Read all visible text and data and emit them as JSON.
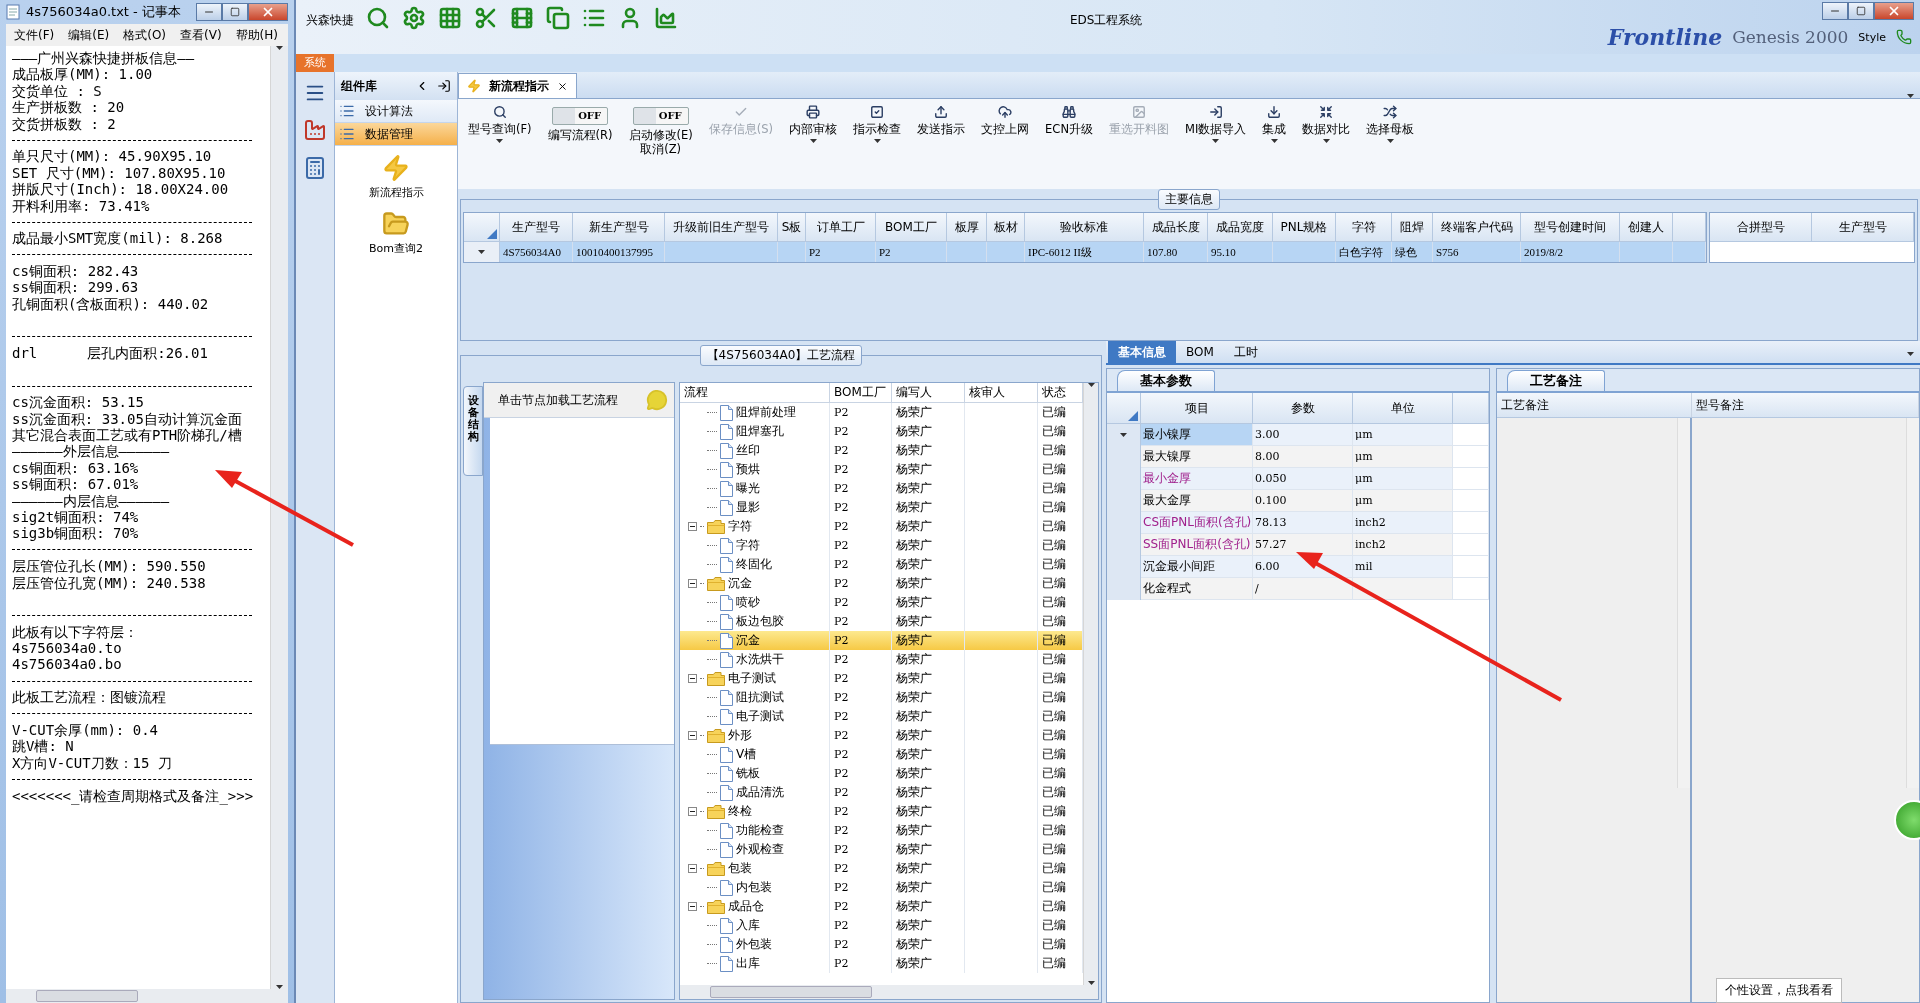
{
  "notepad": {
    "title": "4s756034a0.txt - 记事本",
    "menu": [
      "文件(F)",
      "编辑(E)",
      "格式(O)",
      "查看(V)",
      "帮助(H)"
    ],
    "lines": [
      {
        "kind": "text",
        "text": "———广州兴森快捷拼板信息——"
      },
      {
        "kind": "text",
        "text": "成品板厚(MM): 1.00"
      },
      {
        "kind": "text",
        "text": "交货单位 : S"
      },
      {
        "kind": "text",
        "text": "生产拼板数 : 20"
      },
      {
        "kind": "text",
        "text": "交货拼板数 : 2"
      },
      {
        "kind": "rule"
      },
      {
        "kind": "text",
        "text": "单只尺寸(MM): 45.90X95.10"
      },
      {
        "kind": "text",
        "text": "SET 尺寸(MM): 107.80X95.10"
      },
      {
        "kind": "text",
        "text": "拼版尺寸(Inch): 18.00X24.00"
      },
      {
        "kind": "text",
        "text": "开料利用率: 73.41%"
      },
      {
        "kind": "rule"
      },
      {
        "kind": "text",
        "text": "成品最小SMT宽度(mil): 8.268"
      },
      {
        "kind": "rule"
      },
      {
        "kind": "text",
        "text": "cs铜面积: 282.43"
      },
      {
        "kind": "text",
        "text": "ss铜面积: 299.63"
      },
      {
        "kind": "text",
        "text": "孔铜面积(含板面积): 440.02"
      },
      {
        "kind": "gap"
      },
      {
        "kind": "rule"
      },
      {
        "kind": "split",
        "left": "drl",
        "right": "层孔内面积:26.01"
      },
      {
        "kind": "gap"
      },
      {
        "kind": "rule"
      },
      {
        "kind": "text",
        "text": "cs沉金面积: 53.15"
      },
      {
        "kind": "text",
        "text": "ss沉金面积: 33.05自动计算沉金面"
      },
      {
        "kind": "text",
        "text": "其它混合表面工艺或有PTH阶梯孔/槽"
      },
      {
        "kind": "text",
        "text": "——————外层信息——————"
      },
      {
        "kind": "text",
        "text": "cs铜面积: 63.16%"
      },
      {
        "kind": "text",
        "text": "ss铜面积: 67.01%"
      },
      {
        "kind": "text",
        "text": "——————内层信息——————"
      },
      {
        "kind": "text",
        "text": "sig2t铜面积: 74%"
      },
      {
        "kind": "text",
        "text": "sig3b铜面积: 70%"
      },
      {
        "kind": "rule"
      },
      {
        "kind": "text",
        "text": "层压管位孔长(MM): 590.550"
      },
      {
        "kind": "text",
        "text": "层压管位孔宽(MM): 240.538"
      },
      {
        "kind": "gap"
      },
      {
        "kind": "rule"
      },
      {
        "kind": "text",
        "text": "此板有以下字符层："
      },
      {
        "kind": "text",
        "text": "4s756034a0.to"
      },
      {
        "kind": "text",
        "text": "4s756034a0.bo"
      },
      {
        "kind": "rule"
      },
      {
        "kind": "text",
        "text": "此板工艺流程：图镀流程"
      },
      {
        "kind": "rule"
      },
      {
        "kind": "text",
        "text": "V-CUT余厚(mm): 0.4"
      },
      {
        "kind": "text",
        "text": "跳V槽: N"
      },
      {
        "kind": "text",
        "text": "X方向V-CUT刀数：15 刀"
      },
      {
        "kind": "rule"
      },
      {
        "kind": "text",
        "text": "<<<<<<<_请检查周期格式及备注_>>>"
      }
    ]
  },
  "app": {
    "quick_name": "兴森快捷",
    "title": "EDS工程系统",
    "backdrop": [
      "Frontline",
      "Genesis 2000",
      "Style"
    ],
    "ribbon_tab": "系统"
  },
  "component_panel": {
    "title": "组件库",
    "items": [
      {
        "label": "设计算法",
        "selected": false
      },
      {
        "label": "数据管理",
        "selected": true
      }
    ],
    "shortcuts": [
      {
        "kind": "bolt",
        "label": "新流程指示"
      },
      {
        "kind": "folder",
        "label": "Bom查询2"
      }
    ]
  },
  "document_tab": {
    "label": "新流程指示",
    "selected": true
  },
  "toolbar": {
    "items": [
      {
        "kind": "button",
        "label": "型号查询(F)",
        "disabled": false,
        "caret": true
      },
      {
        "kind": "toggle",
        "switch": "OFF",
        "on": false,
        "label": "编写流程(R)"
      },
      {
        "kind": "toggle",
        "switch": "OFF",
        "on": false,
        "label": "启动修改(E)",
        "label2": "取消(Z)"
      },
      {
        "kind": "button",
        "label": "保存信息(S)",
        "disabled": true,
        "caret": false
      },
      {
        "kind": "button",
        "label": "内部审核",
        "disabled": false,
        "caret": true
      },
      {
        "kind": "button",
        "label": "指示检查",
        "disabled": false,
        "caret": true
      },
      {
        "kind": "button",
        "label": "发送指示",
        "disabled": false,
        "caret": false
      },
      {
        "kind": "button",
        "label": "文控上网",
        "disabled": false,
        "caret": false
      },
      {
        "kind": "button",
        "label": "ECN升级",
        "disabled": false,
        "caret": false
      },
      {
        "kind": "button",
        "label": "重选开料图",
        "disabled": true,
        "caret": false
      },
      {
        "kind": "button",
        "label": "MI数据导入",
        "disabled": false,
        "caret": true
      },
      {
        "kind": "button",
        "label": "集成",
        "disabled": false,
        "caret": true
      },
      {
        "kind": "button",
        "label": "数据对比",
        "disabled": false,
        "caret": true
      },
      {
        "kind": "button",
        "label": "选择母板",
        "disabled": false,
        "caret": true
      }
    ]
  },
  "main_info": {
    "title": "主要信息",
    "columns": [
      "生产型号",
      "新生产型号",
      "升级前旧生产型号",
      "S板",
      "订单工厂",
      "BOM工厂",
      "板厚",
      "板材",
      "验收标准",
      "成品长度",
      "成品宽度",
      "PNL规格",
      "字符",
      "阻焊",
      "终端客户代码",
      "型号创建时间",
      "创建人"
    ],
    "rows": [
      {
        "selected": true,
        "cells": [
          "4S756034A0",
          "10010400137995",
          null,
          null,
          "P2",
          "P2",
          null,
          null,
          "IPC-6012 II级",
          "107.80",
          "95.10",
          null,
          "白色字符",
          "绿色",
          "S756",
          "2019/8/2",
          null
        ]
      }
    ],
    "merge_columns": [
      "合拼型号",
      "生产型号"
    ]
  },
  "process": {
    "title": "【4S756034A0】工艺流程",
    "side_tab": "设备结构",
    "hint": "单击节点加载工艺流程",
    "columns": [
      "流程",
      "BOM工厂",
      "编写人",
      "核审人",
      "状态"
    ],
    "tree": [
      {
        "kind": "group",
        "children": [
          {
            "kind": "step",
            "label": "阻焊前处理",
            "factory": "P2",
            "writer": "杨荣广",
            "status": "已编",
            "selected": false
          },
          {
            "kind": "step",
            "label": "阻焊塞孔",
            "factory": "P2",
            "writer": "杨荣广",
            "status": "已编",
            "selected": false
          },
          {
            "kind": "step",
            "label": "丝印",
            "factory": "P2",
            "writer": "杨荣广",
            "status": "已编",
            "selected": false
          },
          {
            "kind": "step",
            "label": "预烘",
            "factory": "P2",
            "writer": "杨荣广",
            "status": "已编",
            "selected": false
          },
          {
            "kind": "step",
            "label": "曝光",
            "factory": "P2",
            "writer": "杨荣广",
            "status": "已编",
            "selected": false
          },
          {
            "kind": "step",
            "label": "显影",
            "factory": "P2",
            "writer": "杨荣广",
            "status": "已编",
            "selected": false
          }
        ]
      },
      {
        "kind": "folder",
        "label": "字符",
        "expanded": true,
        "factory": "P2",
        "writer": "杨荣广",
        "status": "已编",
        "selected": false,
        "children": [
          {
            "kind": "step",
            "label": "字符",
            "factory": "P2",
            "writer": "杨荣广",
            "status": "已编",
            "selected": false
          },
          {
            "kind": "step",
            "label": "终固化",
            "factory": "P2",
            "writer": "杨荣广",
            "status": "已编",
            "selected": false
          }
        ]
      },
      {
        "kind": "folder",
        "label": "沉金",
        "expanded": true,
        "factory": "P2",
        "writer": "杨荣广",
        "status": "已编",
        "selected": false,
        "children": [
          {
            "kind": "step",
            "label": "喷砂",
            "factory": "P2",
            "writer": "杨荣广",
            "status": "已编",
            "selected": false
          },
          {
            "kind": "step",
            "label": "板边包胶",
            "factory": "P2",
            "writer": "杨荣广",
            "status": "已编",
            "selected": false
          },
          {
            "kind": "step",
            "label": "沉金",
            "factory": "P2",
            "writer": "杨荣广",
            "status": "已编",
            "selected": true
          },
          {
            "kind": "step",
            "label": "水洗烘干",
            "factory": "P2",
            "writer": "杨荣广",
            "status": "已编",
            "selected": false
          }
        ]
      },
      {
        "kind": "folder",
        "label": "电子测试",
        "expanded": true,
        "factory": "P2",
        "writer": "杨荣广",
        "status": "已编",
        "selected": false,
        "children": [
          {
            "kind": "step",
            "label": "阻抗测试",
            "factory": "P2",
            "writer": "杨荣广",
            "status": "已编",
            "selected": false
          },
          {
            "kind": "step",
            "label": "电子测试",
            "factory": "P2",
            "writer": "杨荣广",
            "status": "已编",
            "selected": false
          }
        ]
      },
      {
        "kind": "folder",
        "label": "外形",
        "expanded": true,
        "factory": "P2",
        "writer": "杨荣广",
        "status": "已编",
        "selected": false,
        "children": [
          {
            "kind": "step",
            "label": "V槽",
            "factory": "P2",
            "writer": "杨荣广",
            "status": "已编",
            "selected": false
          },
          {
            "kind": "step",
            "label": "铣板",
            "factory": "P2",
            "writer": "杨荣广",
            "status": "已编",
            "selected": false
          },
          {
            "kind": "step",
            "label": "成品清洗",
            "factory": "P2",
            "writer": "杨荣广",
            "status": "已编",
            "selected": false
          }
        ]
      },
      {
        "kind": "folder",
        "label": "终检",
        "expanded": true,
        "factory": "P2",
        "writer": "杨荣广",
        "status": "已编",
        "selected": false,
        "children": [
          {
            "kind": "step",
            "label": "功能检查",
            "factory": "P2",
            "writer": "杨荣广",
            "status": "已编",
            "selected": false
          },
          {
            "kind": "step",
            "label": "外观检查",
            "factory": "P2",
            "writer": "杨荣广",
            "status": "已编",
            "selected": false
          }
        ]
      },
      {
        "kind": "folder",
        "label": "包装",
        "expanded": true,
        "factory": "P2",
        "writer": "杨荣广",
        "status": "已编",
        "selected": false,
        "children": [
          {
            "kind": "step",
            "label": "内包装",
            "factory": "P2",
            "writer": "杨荣广",
            "status": "已编",
            "selected": false
          }
        ]
      },
      {
        "kind": "folder",
        "label": "成品仓",
        "expanded": true,
        "factory": "P2",
        "writer": "杨荣广",
        "status": "已编",
        "selected": false,
        "children": [
          {
            "kind": "step",
            "label": "入库",
            "factory": "P2",
            "writer": "杨荣广",
            "status": "已编",
            "selected": false
          },
          {
            "kind": "step",
            "label": "外包装",
            "factory": "P2",
            "writer": "杨荣广",
            "status": "已编",
            "selected": false
          },
          {
            "kind": "step",
            "label": "出库",
            "factory": "P2",
            "writer": "杨荣广",
            "status": "已编",
            "selected": false
          }
        ]
      }
    ]
  },
  "detail": {
    "tabs": [
      {
        "label": "基本信息",
        "selected": true
      },
      {
        "label": "BOM",
        "selected": false
      },
      {
        "label": "工时",
        "selected": false
      }
    ],
    "params": {
      "title": "基本参数",
      "columns": [
        "项目",
        "参数",
        "单位"
      ],
      "rows": [
        {
          "item": "最小镍厚",
          "value": "3.00",
          "unit": "μm",
          "highlighted": false,
          "selected": true
        },
        {
          "item": "最大镍厚",
          "value": "8.00",
          "unit": "μm",
          "highlighted": false,
          "selected": false
        },
        {
          "item": "最小金厚",
          "value": "0.050",
          "unit": "μm",
          "highlighted": true,
          "selected": false
        },
        {
          "item": "最大金厚",
          "value": "0.100",
          "unit": "μm",
          "highlighted": false,
          "selected": false
        },
        {
          "item": "CS面PNL面积(含孔)",
          "value": "78.13",
          "unit": "inch2",
          "highlighted": true,
          "selected": false
        },
        {
          "item": "SS面PNL面积(含孔)",
          "value": "57.27",
          "unit": "inch2",
          "highlighted": true,
          "selected": false
        },
        {
          "item": "沉金最小间距",
          "value": "6.00",
          "unit": "mil",
          "highlighted": false,
          "selected": false
        },
        {
          "item": "化金程式",
          "value": "/",
          "highlighted": false,
          "selected": false
        }
      ]
    },
    "notes": {
      "title": "工艺备注",
      "columns": [
        "工艺备注",
        "型号备注"
      ]
    }
  },
  "tooltip": "个性设置，点我看看"
}
